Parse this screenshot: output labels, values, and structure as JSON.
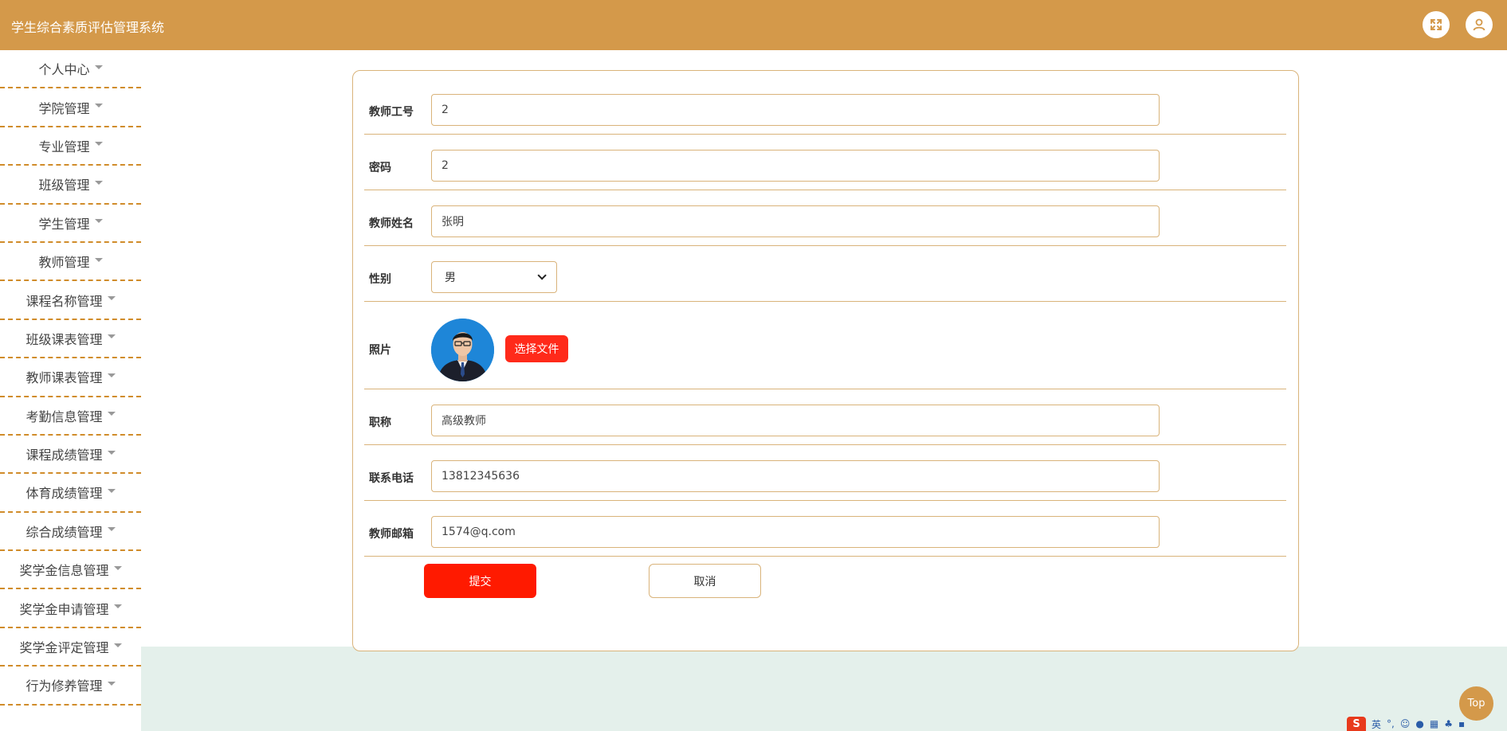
{
  "header": {
    "title": "学生综合素质评估管理系统"
  },
  "icons": {
    "fullscreen": "fullscreen-icon",
    "user": "user-icon"
  },
  "sidebar": {
    "items": [
      {
        "label": "个人中心"
      },
      {
        "label": "学院管理"
      },
      {
        "label": "专业管理"
      },
      {
        "label": "班级管理"
      },
      {
        "label": "学生管理"
      },
      {
        "label": "教师管理"
      },
      {
        "label": "课程名称管理"
      },
      {
        "label": "班级课表管理"
      },
      {
        "label": "教师课表管理"
      },
      {
        "label": "考勤信息管理"
      },
      {
        "label": "课程成绩管理"
      },
      {
        "label": "体育成绩管理"
      },
      {
        "label": "综合成绩管理"
      },
      {
        "label": "奖学金信息管理"
      },
      {
        "label": "奖学金申请管理"
      },
      {
        "label": "奖学金评定管理"
      },
      {
        "label": "行为修养管理"
      }
    ]
  },
  "form": {
    "teacher_id": {
      "label": "教师工号",
      "value": "2"
    },
    "password": {
      "label": "密码",
      "value": "2"
    },
    "name": {
      "label": "教师姓名",
      "value": "张明"
    },
    "gender": {
      "label": "性别",
      "value": "男"
    },
    "photo": {
      "label": "照片",
      "button": "选择文件"
    },
    "title": {
      "label": "职称",
      "value": "高级教师"
    },
    "phone": {
      "label": "联系电话",
      "value": "13812345636"
    },
    "email": {
      "label": "教师邮箱",
      "value": "1574@q.com"
    },
    "submit": "提交",
    "cancel": "取消"
  },
  "back_to_top": "Top",
  "ime": {
    "lang": "英"
  },
  "colors": {
    "header": "#d4994a",
    "accent": "#ff1a00",
    "border": "#d9b37a",
    "content_bg": "#e4f0eb"
  }
}
